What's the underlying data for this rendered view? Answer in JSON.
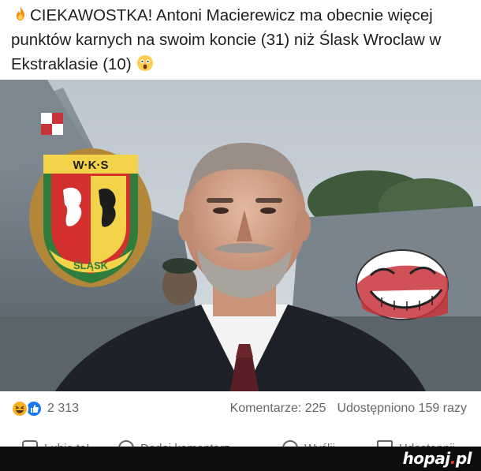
{
  "post": {
    "text_part1": "CIEKAWOSTKA! Antoni Macierewicz ma obecnie więcej punktów karnych na swoim koncie (31) niż Ślask Wroclaw w Ekstraklasie (10)",
    "emoji_lead": "fire-icon",
    "emoji_trail": "astonished-face-icon"
  },
  "image": {
    "badge_text": "W·K·S",
    "badge_ribbon": "ŚLĄSK"
  },
  "stats": {
    "reaction_icons": [
      "haha-icon",
      "like-icon"
    ],
    "reaction_count": "2 313",
    "comments": "Komentarze: 225",
    "shares": "Udostępniono 159 razy"
  },
  "actions": [
    {
      "label": "Lubię to!",
      "icon": "like-icon"
    },
    {
      "label": "Dodaj komentarz",
      "icon": "comment-icon"
    },
    {
      "label": "Wyślij",
      "icon": "messenger-icon"
    },
    {
      "label": "Udostępnij",
      "icon": "share-icon"
    }
  ],
  "footer": {
    "brand_main": "hopaj",
    "brand_dot": ".",
    "brand_tld": "pl"
  },
  "colors": {
    "facebook_blue": "#1877f2",
    "text_gray": "#65676b",
    "brand_accent": "#e8412c"
  }
}
